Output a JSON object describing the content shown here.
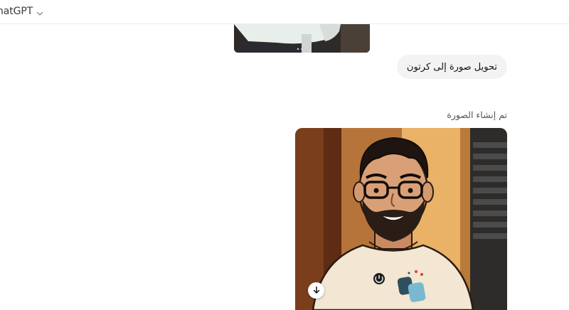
{
  "header": {
    "model_name": "hatGPT",
    "model_chevron_icon": "chevron-down-icon"
  },
  "conversation": {
    "uploaded_image_icon": "photo",
    "user_message": "تحويل صورة إلى كرتون",
    "assistant_status": "تم إنشاء الصورة",
    "generated_image_icon": "cartoon-portrait",
    "download_icon": "arrow-down-icon"
  }
}
